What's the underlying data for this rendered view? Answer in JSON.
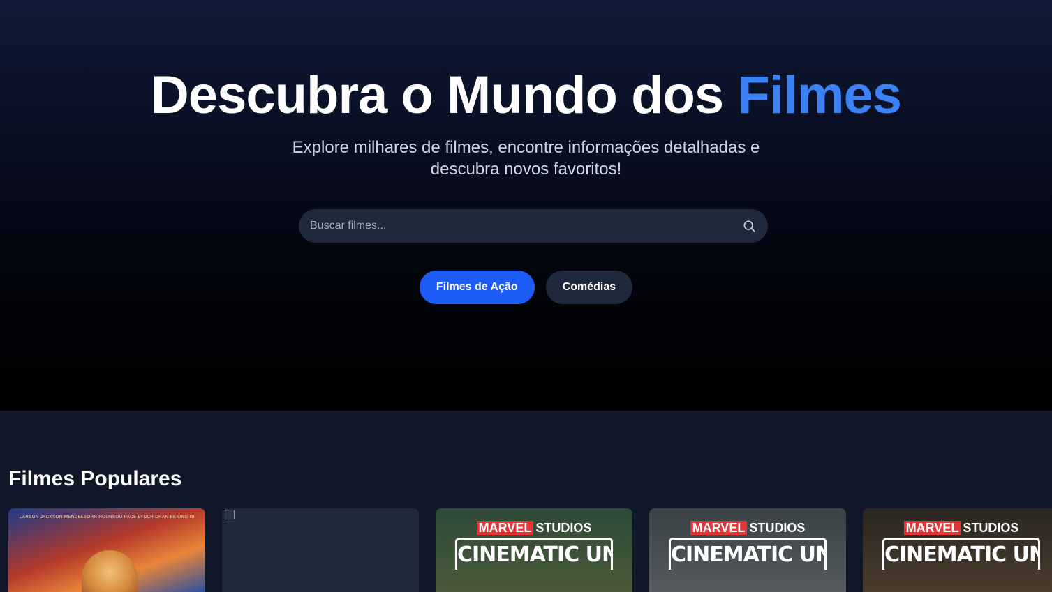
{
  "hero": {
    "title_main": "Descubra o Mundo dos ",
    "title_accent": "Filmes",
    "subtitle": "Explore milhares de filmes, encontre informações detalhadas e descubra novos favoritos!"
  },
  "search": {
    "placeholder": "Buscar filmes...",
    "value": "",
    "icon": "search-icon"
  },
  "categories": [
    {
      "label": "Filmes de Ação",
      "active": true
    },
    {
      "label": "Comédias",
      "active": false
    }
  ],
  "popular": {
    "title": "Filmes Populares",
    "posters": [
      {
        "credits": "LARSON  JACKSON  MENDELSOHN  HOUNSOU  PACE  LYNCH  CHAN  BENING  GREGG  LAW"
      },
      {
        "broken": true
      },
      {
        "brand_a": "MARVEL",
        "brand_b": "STUDIOS",
        "title": "CINEMATIC UNIVERSE"
      },
      {
        "brand_a": "MARVEL",
        "brand_b": "STUDIOS",
        "title": "CINEMATIC UNIVERSE"
      },
      {
        "brand_a": "MARVEL",
        "brand_b": "STUDIOS",
        "title": "CINEMATIC UNIVERSE"
      }
    ]
  },
  "colors": {
    "accent": "#3b82f6",
    "primary_button": "#1d5cf6",
    "surface": "#1e293b",
    "page_bg": "#0f1729"
  }
}
